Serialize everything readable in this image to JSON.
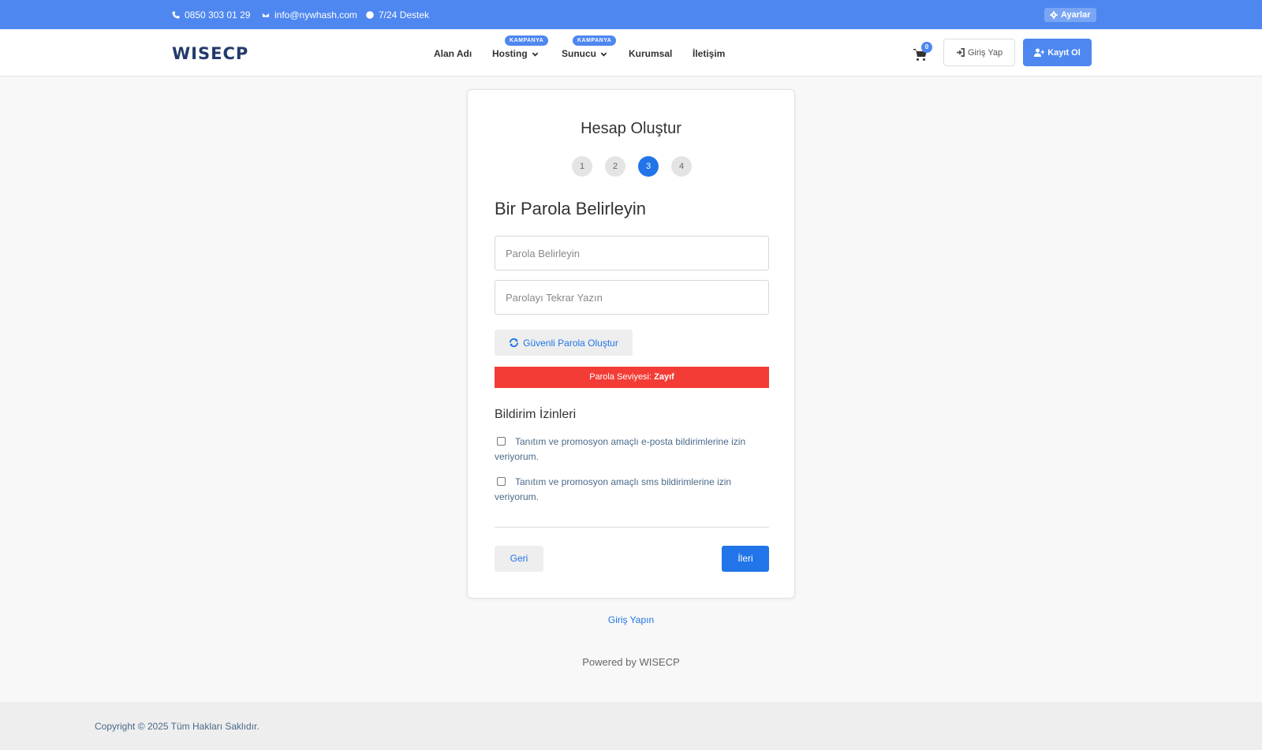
{
  "topbar": {
    "phone": "0850 303 01 29",
    "email": "info@nywhash.com",
    "support": "7/24 Destek",
    "settings_label": "Ayarlar"
  },
  "header": {
    "logo": "WISECP",
    "nav": [
      {
        "label": "Alan Adı"
      },
      {
        "label": "Hosting",
        "badge": "KAMPANYA"
      },
      {
        "label": "Sunucu",
        "badge": "KAMPANYA"
      },
      {
        "label": "Kurumsal"
      },
      {
        "label": "İletişim"
      }
    ],
    "cart_count": "0",
    "login_label": "Giriş Yap",
    "register_label": "Kayıt Ol"
  },
  "card": {
    "title": "Hesap Oluştur",
    "steps": [
      "1",
      "2",
      "3",
      "4"
    ],
    "active_step": 3,
    "section_title": "Bir Parola Belirleyin",
    "password_placeholder": "Parola Belirleyin",
    "password_repeat_placeholder": "Parolayı Tekrar Yazın",
    "generate_label": "Güvenli Parola Oluştur",
    "strength_label": "Parola Seviyesi:",
    "strength_value": "Zayıf",
    "permissions_title": "Bildirim İzinleri",
    "permissions": [
      "Tanıtım ve promosyon amaçlı e-posta bildirimlerine izin veriyorum.",
      "Tanıtım ve promosyon amaçlı sms bildirimlerine izin veriyorum."
    ],
    "back_label": "Geri",
    "next_label": "İleri"
  },
  "login_link": "Giriş Yapın",
  "powered_by": "Powered by WISECP",
  "footer": {
    "copyright": "Copyright © 2025 Tüm Hakları Saklıdır."
  },
  "colors": {
    "primary": "#4e87f0",
    "accent": "#2175e8",
    "danger": "#f33c35"
  }
}
